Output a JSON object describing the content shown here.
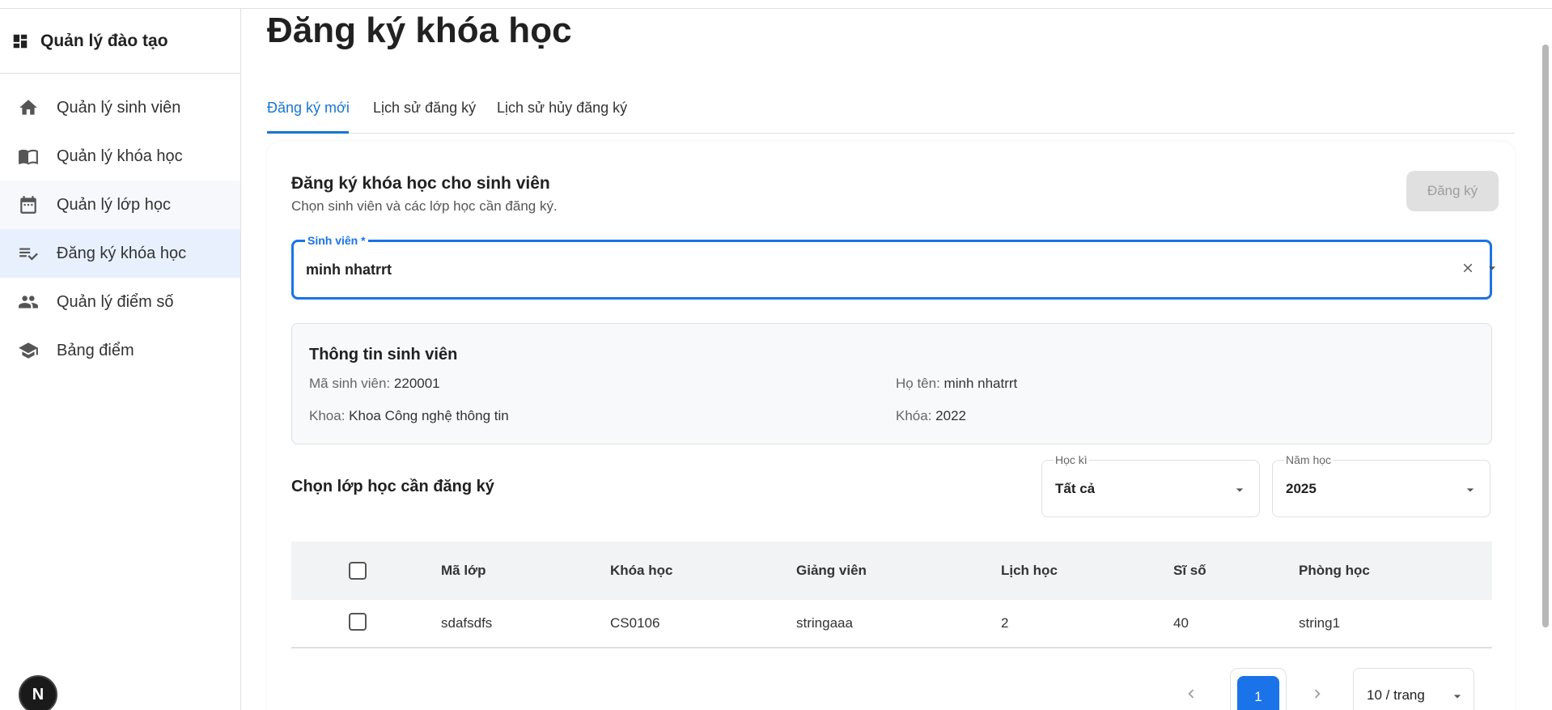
{
  "app": {
    "title": "Quản lý đào tạo",
    "logo_icon": "dashboard-icon"
  },
  "sidebar": {
    "items": [
      {
        "label": "Quản lý sinh viên",
        "icon": "home-icon"
      },
      {
        "label": "Quản lý khóa học",
        "icon": "book-open-icon"
      },
      {
        "label": "Quản lý lớp học",
        "icon": "calendar-icon"
      },
      {
        "label": "Đăng ký khóa học",
        "icon": "playlist-check-icon",
        "active": true
      },
      {
        "label": "Quản lý điểm số",
        "icon": "people-icon"
      },
      {
        "label": "Bảng điểm",
        "icon": "school-icon"
      }
    ],
    "badge_text": "N"
  },
  "page": {
    "title": "Đăng ký khóa học",
    "tabs": [
      {
        "label": "Đăng ký mới",
        "active": true
      },
      {
        "label": "Lịch sử đăng ký"
      },
      {
        "label": "Lịch sử hủy đăng ký"
      }
    ]
  },
  "form": {
    "title": "Đăng ký khóa học cho sinh viên",
    "subtitle": "Chọn sinh viên và các lớp học cần đăng ký.",
    "submit_label": "Đăng ký",
    "student_field": {
      "label": "Sinh viên *",
      "value": "minh nhatrrt"
    }
  },
  "student_info": {
    "title": "Thông tin sinh viên",
    "student_id_label": "Mã sinh viên:",
    "student_id": "220001",
    "name_label": "Họ tên:",
    "name": "minh nhatrrt",
    "faculty_label": "Khoa:",
    "faculty": "Khoa Công nghệ thông tin",
    "cohort_label": "Khóa:",
    "cohort": "2022"
  },
  "class_select": {
    "title": "Chọn lớp học cần đăng ký",
    "semester": {
      "label": "Học kì",
      "value": "Tất cả"
    },
    "year": {
      "label": "Năm học",
      "value": "2025"
    }
  },
  "table": {
    "columns": [
      "Mã lớp",
      "Khóa học",
      "Giảng viên",
      "Lịch học",
      "Sĩ số",
      "Phòng học"
    ],
    "rows": [
      {
        "class_code": "sdafsdfs",
        "course": "CS0106",
        "lecturer": "stringaaa",
        "schedule": "2",
        "capacity": "40",
        "room": "string1",
        "checked": false
      }
    ]
  },
  "pagination": {
    "current_page": "1",
    "page_size": "10 / trang"
  },
  "colors": {
    "accent": "#1a73e8",
    "active_nav_bg": "#e8f0fe",
    "disabled_button_bg": "#e0e0e0"
  }
}
